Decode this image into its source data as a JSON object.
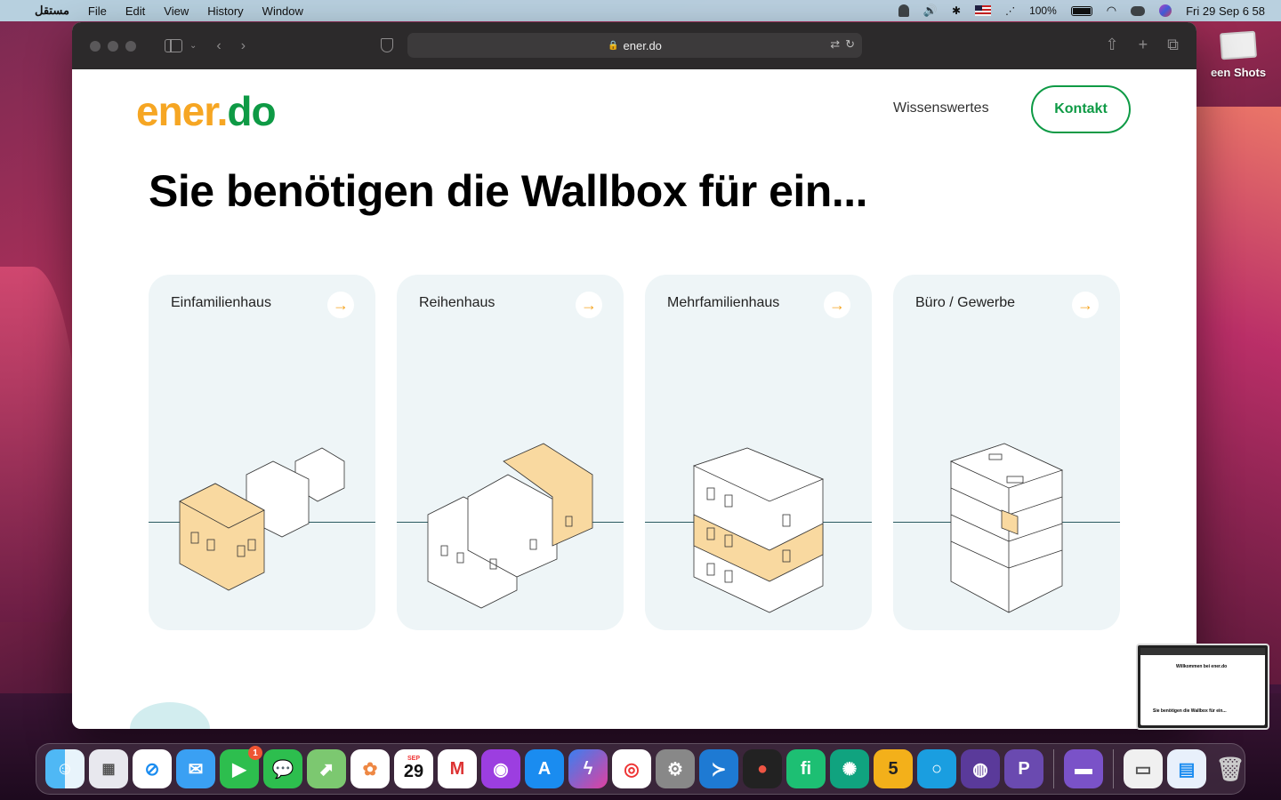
{
  "menubar": {
    "app_name": "مستقل",
    "menus": [
      "File",
      "Edit",
      "View",
      "History",
      "Window"
    ],
    "battery": "100%",
    "datetime": "Fri 29 Sep  6 58"
  },
  "desktop": {
    "screenshots_label": "een Shots"
  },
  "browser": {
    "url": "ener.do"
  },
  "site": {
    "logo_part1": "ener.",
    "logo_part2": "do",
    "nav_link": "Wissenswertes",
    "contact_button": "Kontakt",
    "headline": "Sie benötigen die Wallbox für ein...",
    "cards": [
      {
        "title": "Einfamilienhaus"
      },
      {
        "title": "Reihenhaus"
      },
      {
        "title": "Mehrfamilienhaus"
      },
      {
        "title": "Büro / Gewerbe"
      }
    ],
    "colors": {
      "brand_orange": "#f6a623",
      "brand_green": "#0e9a45",
      "card_bg": "#eef5f7"
    }
  },
  "preview": {
    "title": "Willkommen bei ener.do",
    "headline": "Sie benötigen die Wallbox für ein..."
  },
  "dock": {
    "calendar_month": "SEP",
    "calendar_day": "29",
    "facetime_badge": "1",
    "apps": [
      "Finder",
      "Launchpad",
      "Safari",
      "Mail",
      "FaceTime",
      "Messages",
      "Maps",
      "Photos",
      "Calendar",
      "Gmail",
      "Podcasts",
      "App Store",
      "Messenger",
      "Chrome",
      "System Settings",
      "VS Code",
      "Record",
      "Fiverr",
      "ChatGPT",
      "Five",
      "Opera",
      "Proton",
      "ProtonVPN",
      "Disk Utility",
      "Finder Windows",
      "Preview",
      "Trash"
    ]
  }
}
